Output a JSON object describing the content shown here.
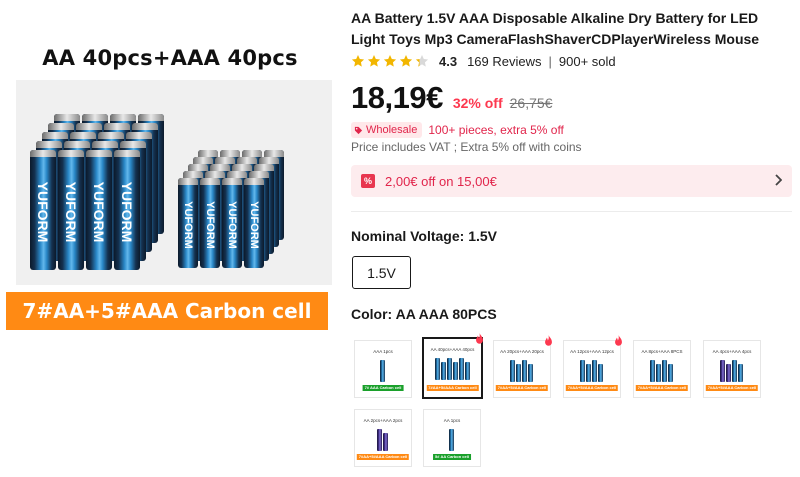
{
  "hero": {
    "caption_top": "AA 40pcs+AAA 40pcs",
    "banner": "7#AA+5#AAA Carbon cell",
    "brand_text": "YUFORM"
  },
  "product": {
    "title": "AA Battery 1.5V AAA Disposable Alkaline Dry Battery for LED Light Toys Mp3 CameraFlashShaverCDPlayerWireless Mouse",
    "rating": 4.3,
    "rating_label": "4.3",
    "reviews": "169 Reviews",
    "sold": "900+ sold",
    "price": "18,19€",
    "discount": "32% off",
    "original_price": "26,75€",
    "wholesale_badge": "Wholesale",
    "wholesale_text": "100+ pieces, extra 5% off",
    "vat_text": "Price includes VAT ; Extra 5% off with coins",
    "coupon_text": "2,00€ off on 15,00€"
  },
  "voltage": {
    "label": "Nominal Voltage: 1.5V",
    "options": [
      "1.5V"
    ]
  },
  "color": {
    "label": "Color: AA AAA 80PCS",
    "options": [
      {
        "top": "AAA  1pcs",
        "bottom": "7# AAA Carbon cell",
        "green": true,
        "hot": false
      },
      {
        "top": "AA 40pcs+AAA 40pcs",
        "bottom": "7#AA+5#AAA Carbon cell",
        "green": false,
        "hot": true
      },
      {
        "top": "AA 20pcs+AAA 20pcs",
        "bottom": "7#AA+5#AAA Carbon cell",
        "green": false,
        "hot": true
      },
      {
        "top": "AA 12pcs+AAA 12pcs",
        "bottom": "7#AA+5#AAA Carbon cell",
        "green": false,
        "hot": true
      },
      {
        "top": "AA 8pcs+AAA 8PCS",
        "bottom": "7#AA+5#AAA Carbon cell",
        "green": false,
        "hot": false
      },
      {
        "top": "AA 4pcs+AAA 4pcs",
        "bottom": "7#AA+5#AAA Carbon cell",
        "green": false,
        "hot": false
      },
      {
        "top": "AA 2pcs+AAA 2pcs",
        "bottom": "7#AA+5#AAA Carbon cell",
        "green": false,
        "hot": false
      },
      {
        "top": "AA   1pcs",
        "bottom": "5# AA   Carbon cell",
        "green": true,
        "hot": false
      }
    ]
  },
  "colors": {
    "accent_red": "#fd384f",
    "banner_orange": "#ff8a14",
    "star_gold": "#f2b600"
  }
}
